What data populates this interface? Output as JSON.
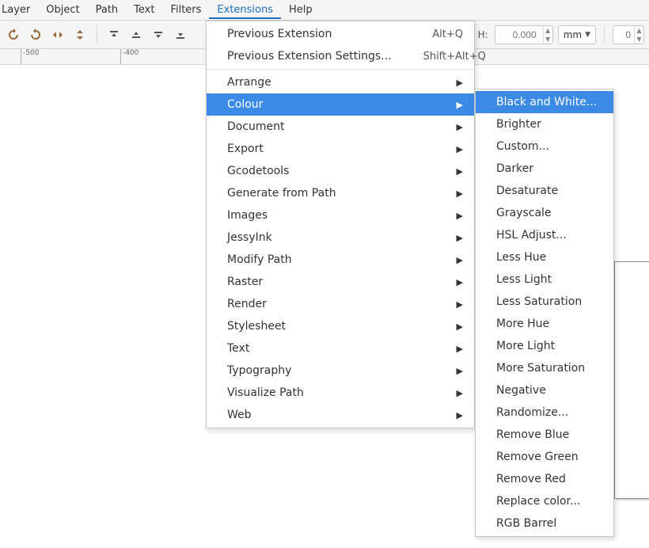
{
  "menubar": {
    "items": [
      "Layer",
      "Object",
      "Path",
      "Text",
      "Filters",
      "Extensions",
      "Help"
    ],
    "active_index": 5
  },
  "toolbar": {
    "h_label": "H:",
    "h_value": "0.000",
    "unit": "mm",
    "second_value": "0"
  },
  "ruler": {
    "ticks": [
      "-500",
      "-400"
    ]
  },
  "extensions_menu": {
    "items": [
      {
        "label": "Previous Extension",
        "accel": "Alt+Q"
      },
      {
        "label": "Previous Extension Settings...",
        "accel": "Shift+Alt+Q"
      },
      {
        "sep": true
      },
      {
        "label": "Arrange",
        "submenu": true
      },
      {
        "label": "Colour",
        "submenu": true,
        "selected": true
      },
      {
        "label": "Document",
        "submenu": true
      },
      {
        "label": "Export",
        "submenu": true
      },
      {
        "label": "Gcodetools",
        "submenu": true
      },
      {
        "label": "Generate from Path",
        "submenu": true
      },
      {
        "label": "Images",
        "submenu": true
      },
      {
        "label": "JessyInk",
        "submenu": true
      },
      {
        "label": "Modify Path",
        "submenu": true
      },
      {
        "label": "Raster",
        "submenu": true
      },
      {
        "label": "Render",
        "submenu": true
      },
      {
        "label": "Stylesheet",
        "submenu": true
      },
      {
        "label": "Text",
        "submenu": true
      },
      {
        "label": "Typography",
        "submenu": true
      },
      {
        "label": "Visualize Path",
        "submenu": true
      },
      {
        "label": "Web",
        "submenu": true
      }
    ]
  },
  "colour_submenu": {
    "items": [
      {
        "label": "Black and White...",
        "selected": true
      },
      {
        "label": "Brighter"
      },
      {
        "label": "Custom..."
      },
      {
        "label": "Darker"
      },
      {
        "label": "Desaturate"
      },
      {
        "label": "Grayscale"
      },
      {
        "label": "HSL Adjust..."
      },
      {
        "label": "Less Hue"
      },
      {
        "label": "Less Light"
      },
      {
        "label": "Less Saturation"
      },
      {
        "label": "More Hue"
      },
      {
        "label": "More Light"
      },
      {
        "label": "More Saturation"
      },
      {
        "label": "Negative"
      },
      {
        "label": "Randomize..."
      },
      {
        "label": "Remove Blue"
      },
      {
        "label": "Remove Green"
      },
      {
        "label": "Remove Red"
      },
      {
        "label": "Replace color..."
      },
      {
        "label": "RGB Barrel"
      }
    ]
  }
}
